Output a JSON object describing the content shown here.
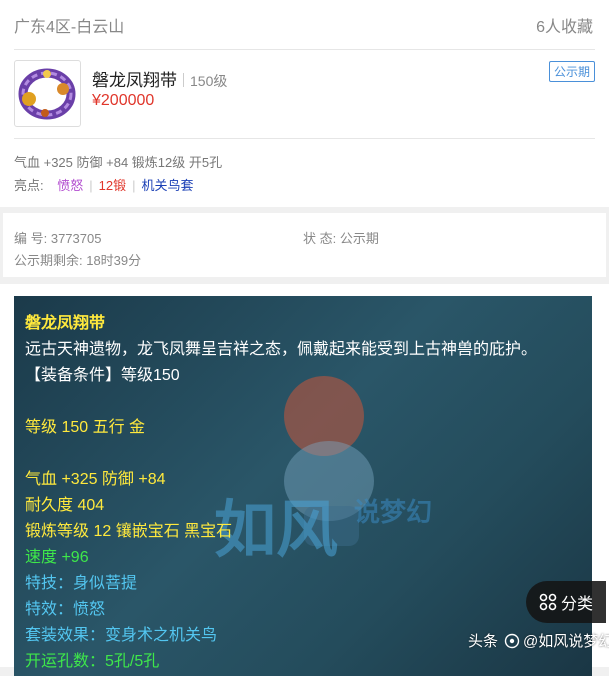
{
  "header": {
    "server": "广东4区-白云山",
    "favorites": "6人收藏"
  },
  "item": {
    "name": "磐龙凤翔带",
    "level": "150级",
    "price": "¥200000",
    "status_badge": "公示期",
    "stats": "气血 +325 防御 +84 锻炼12级 开5孔",
    "highlights_label": "亮点:",
    "highlights": [
      {
        "text": "愤怒",
        "color": "#b34fd0"
      },
      {
        "text": "12锻",
        "color": "#e0362b"
      },
      {
        "text": "机关鸟套",
        "color": "#1a3fb5"
      }
    ]
  },
  "info": {
    "id_label": "编 号: 3773705",
    "status_label": "状 态: 公示期",
    "remaining": "公示期剩余: 18时39分"
  },
  "detail": {
    "name": "磐龙凤翔带",
    "description": "远古天神遗物，龙飞凤舞呈吉祥之态，佩戴起来能受到上古神兽的庇护。",
    "condition": "【装备条件】等级150",
    "grade_line": "等级 150 五行 金",
    "attr_line": "气血 +325 防御 +84",
    "durability": "耐久度 404",
    "forge": "锻炼等级 12 镶嵌宝石 黑宝石",
    "speed": "速度 +96",
    "skill": "特技：身似菩提",
    "effect": "特效：愤怒",
    "set_effect": "套装效果：变身术之机关鸟",
    "holes": "开运孔数：5孔/5孔"
  },
  "watermark": {
    "brand": "如风",
    "sub": "说梦幻"
  },
  "share": {
    "label": "分类"
  },
  "footer": {
    "platform": "头条",
    "account": "@如风说梦幻"
  },
  "colors": {
    "price": "#e0362b",
    "badge": "#4a90d9",
    "panel_bg": "#2a5668"
  }
}
